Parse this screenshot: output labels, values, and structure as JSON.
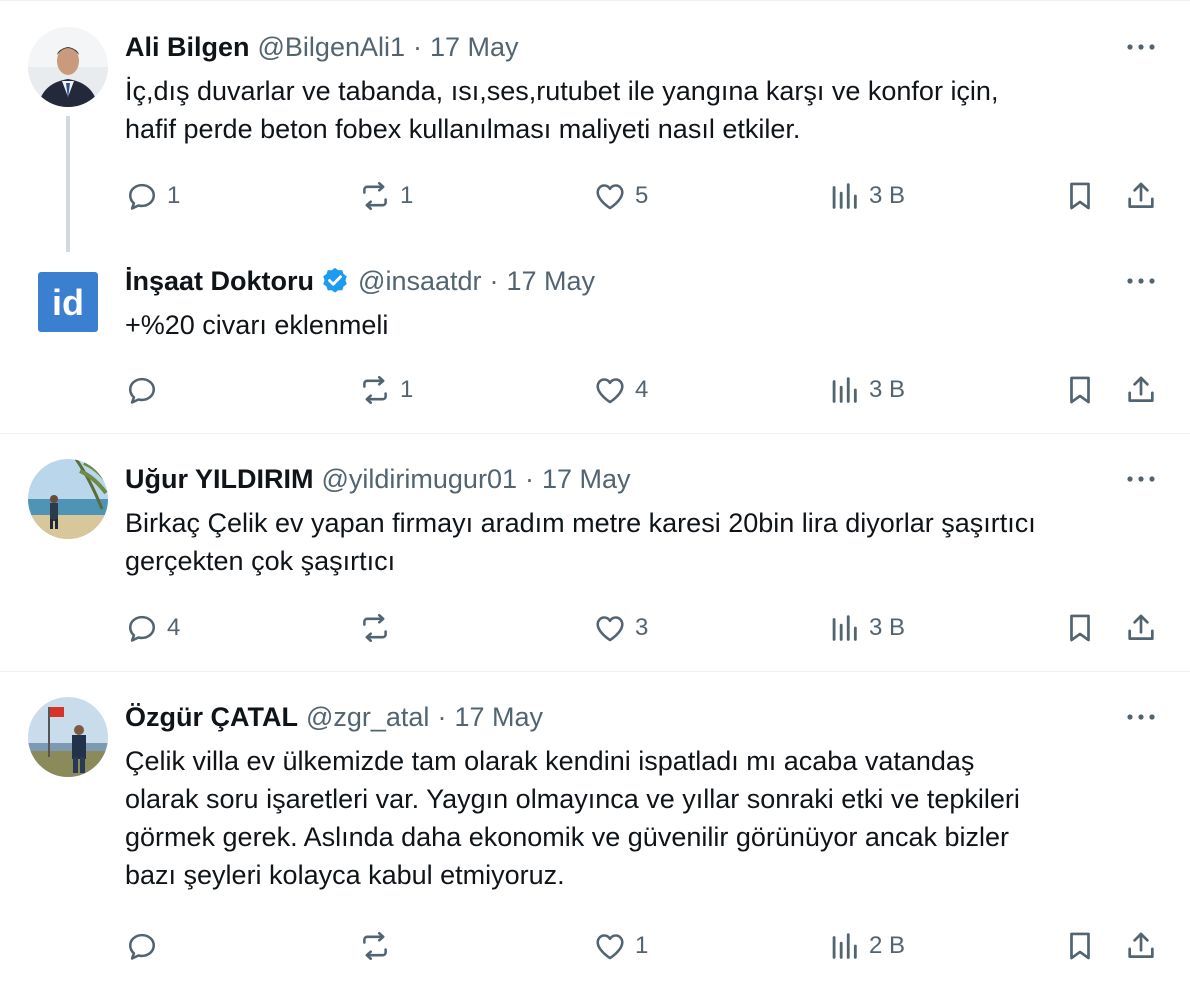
{
  "tweets": [
    {
      "name": "Ali Bilgen",
      "handle": "@BilgenAli1",
      "sep": "·",
      "date": "17 May",
      "verified": false,
      "lines": [
        "İç,dış duvarlar ve tabanda, ısı,ses,rutubet ile yangına karşı ve konfor için,",
        "hafif perde beton fobex kullanılması maliyeti nasıl etkiler."
      ],
      "stats": {
        "replies": "1",
        "reposts": "1",
        "likes": "5",
        "views": "3 B"
      }
    },
    {
      "name": "İnşaat Doktoru",
      "handle": "@insaatdr",
      "sep": "·",
      "date": "17 May",
      "verified": true,
      "avatar_text": "id",
      "lines": [
        "+%20 civarı eklenmeli"
      ],
      "stats": {
        "replies": "",
        "reposts": "1",
        "likes": "4",
        "views": "3 B"
      }
    },
    {
      "name": "Uğur YILDIRIM",
      "handle": "@yildirimugur01",
      "sep": "·",
      "date": "17 May",
      "verified": false,
      "lines": [
        "Birkaç Çelik ev yapan firmayı aradım metre karesi 20bin lira diyorlar şaşırtıcı",
        "gerçekten çok şaşırtıcı"
      ],
      "stats": {
        "replies": "4",
        "reposts": "",
        "likes": "3",
        "views": "3 B"
      }
    },
    {
      "name": "Özgür ÇATAL",
      "handle": "@zgr_atal",
      "sep": "·",
      "date": "17 May",
      "verified": false,
      "lines": [
        "Çelik villa ev ülkemizde tam olarak kendini ispatladı mı acaba vatandaş",
        "olarak soru işaretleri var. Yaygın olmayınca ve yıllar sonraki etki ve tepkileri",
        "görmek gerek. Aslında daha ekonomik ve güvenilir görünüyor ancak bizler",
        "bazı şeyleri kolayca kabul etmiyoruz."
      ],
      "stats": {
        "replies": "",
        "reposts": "",
        "likes": "1",
        "views": "2 B"
      }
    }
  ],
  "icons": {
    "reply": "reply-icon",
    "repost": "repost-icon",
    "like": "like-icon",
    "views": "views-icon",
    "bookmark": "bookmark-icon",
    "share": "share-icon",
    "more": "more-icon",
    "verified": "verified-badge-icon"
  },
  "colors": {
    "text": "#0f1419",
    "secondary": "#536471",
    "verified": "#1d9bf0",
    "brand_avatar": "#3a7fd0",
    "divider": "#eff3f4"
  }
}
